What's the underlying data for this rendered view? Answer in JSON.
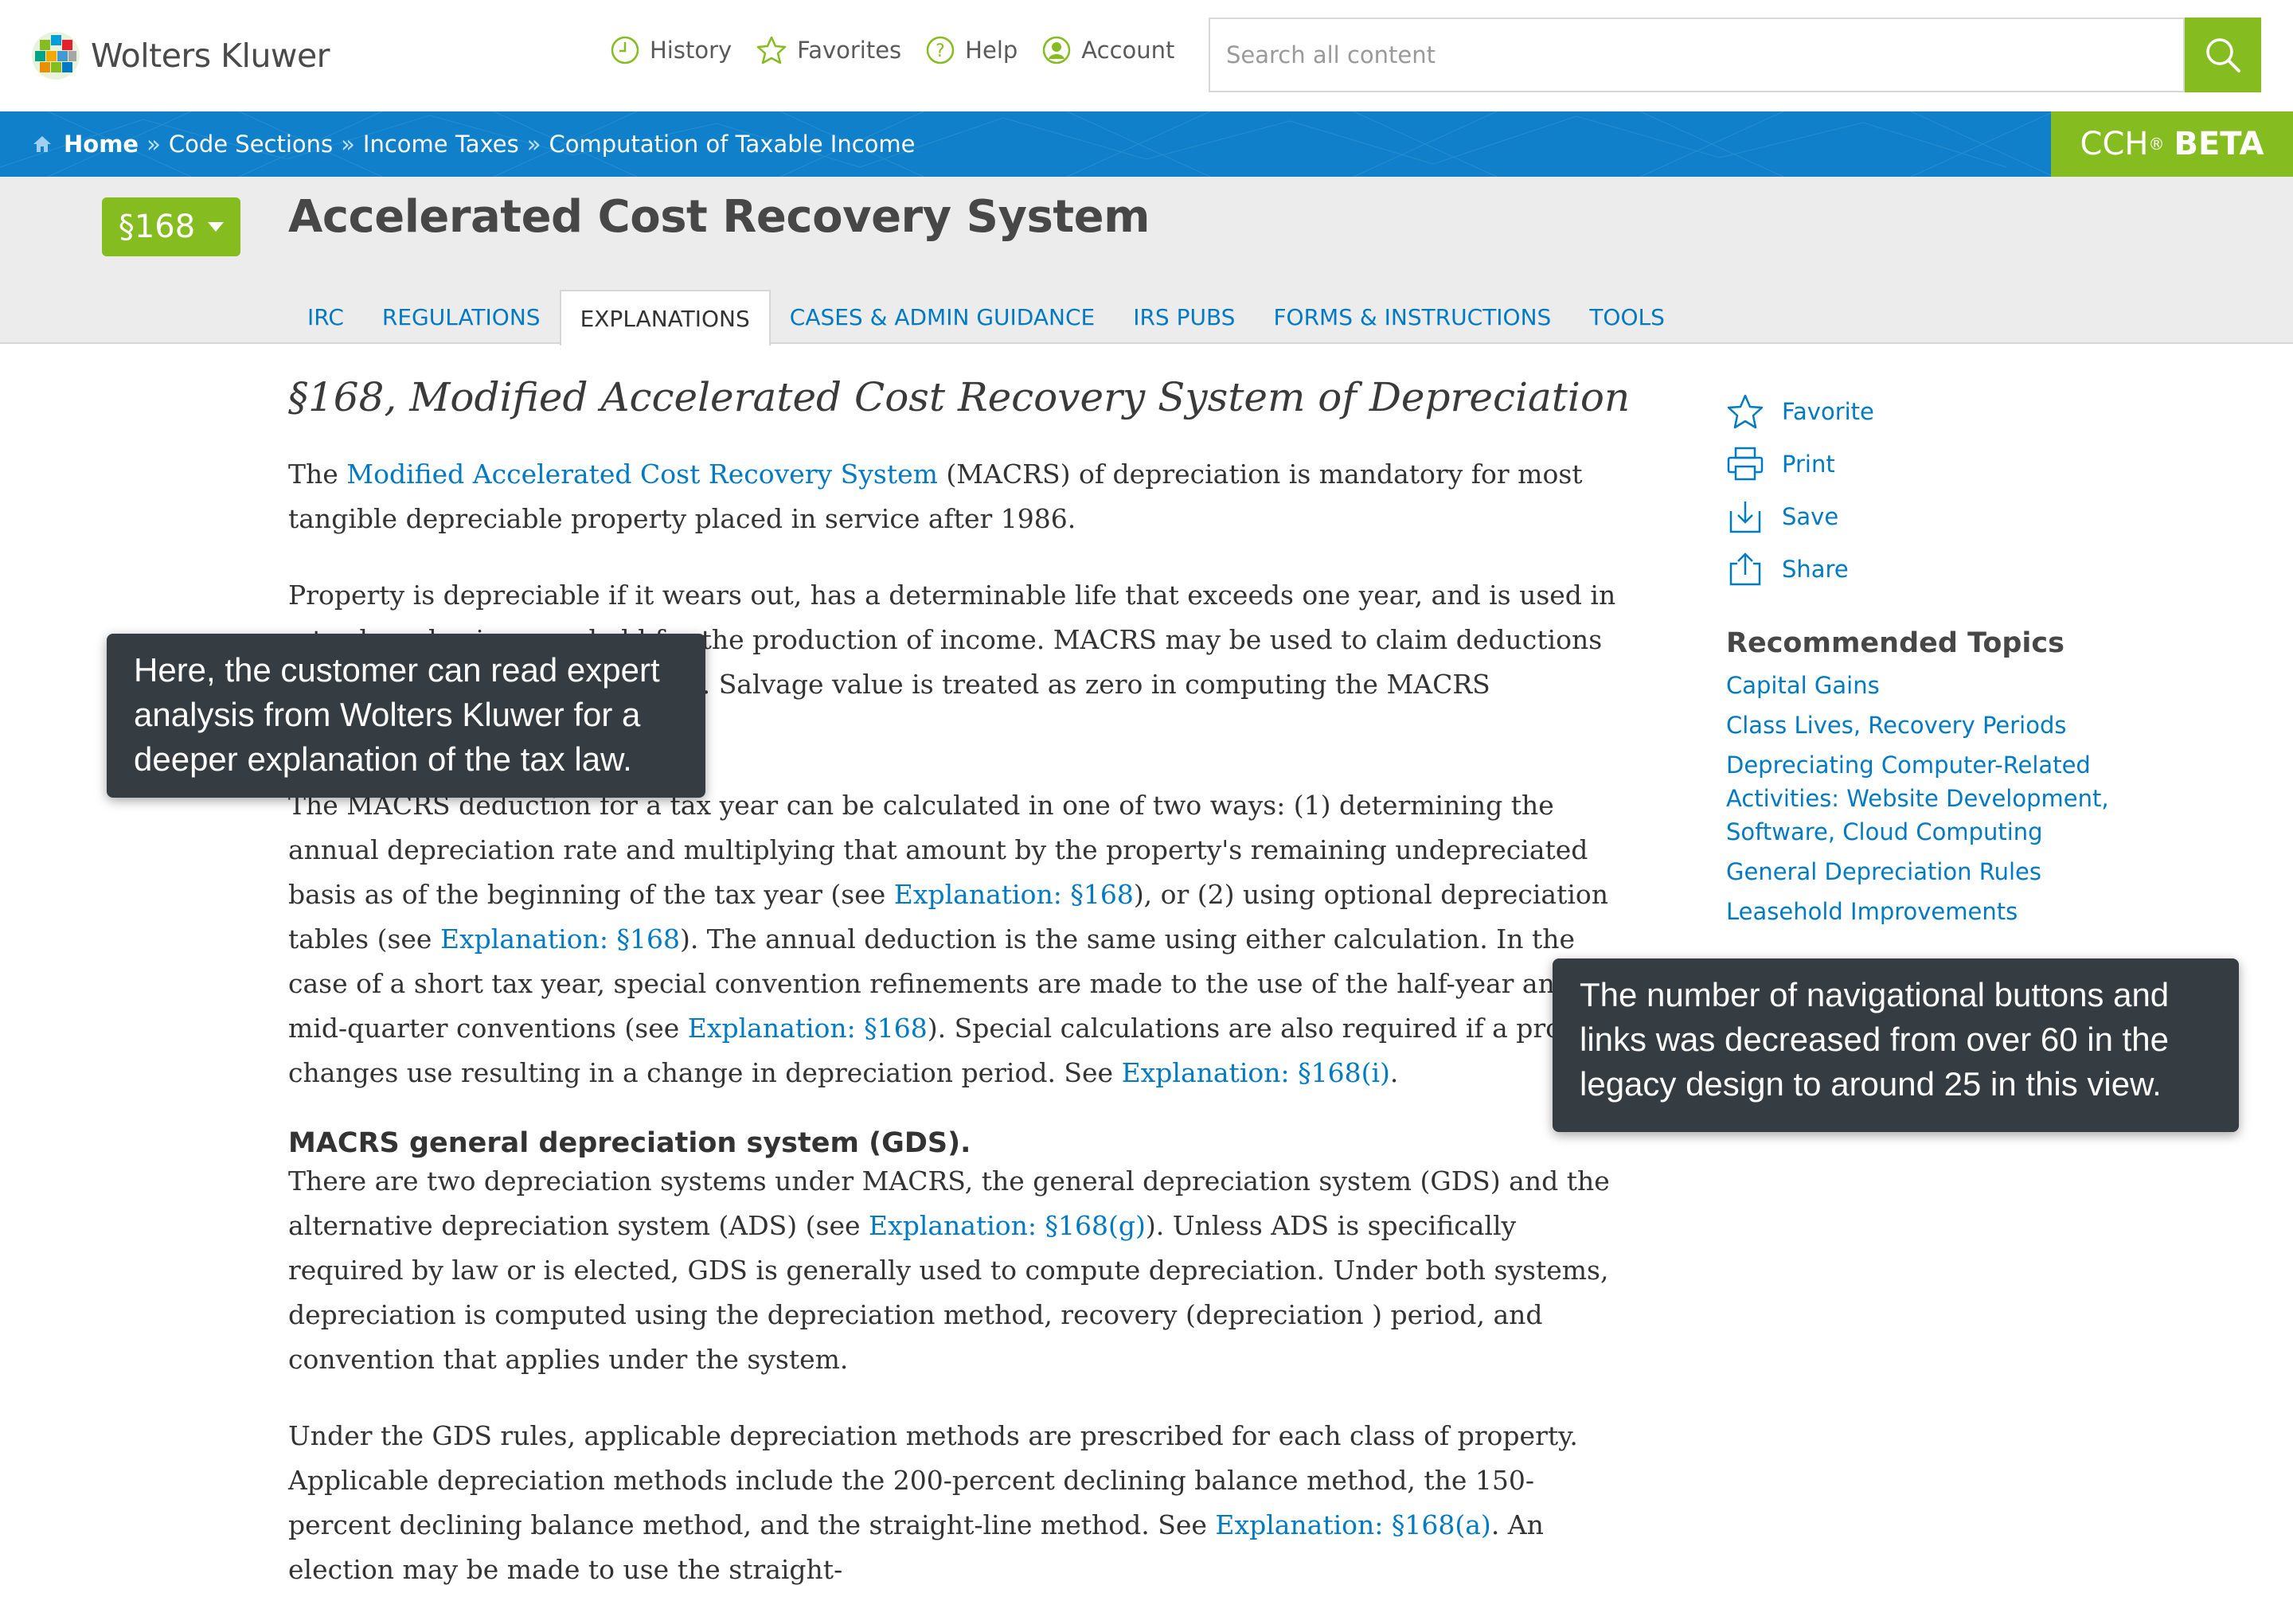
{
  "header": {
    "brand": "Wolters Kluwer",
    "nav": [
      {
        "label": "History",
        "icon": "clock-icon"
      },
      {
        "label": "Favorites",
        "icon": "star-icon"
      },
      {
        "label": "Help",
        "icon": "help-icon"
      },
      {
        "label": "Account",
        "icon": "account-icon"
      }
    ],
    "search_placeholder": "Search all content",
    "colors": {
      "accent": "#85bc20",
      "nav_blue": "#0f80c9",
      "link": "#007ac3"
    }
  },
  "breadcrumb": {
    "items": [
      "Home",
      "Code Sections",
      "Income Taxes",
      "Computation of Taxable Income"
    ],
    "separator": "»",
    "badge_cch": "CCH",
    "badge_reg": "®",
    "badge_beta": "BETA"
  },
  "title_area": {
    "section_button": "§168",
    "title": "Accelerated Cost Recovery System",
    "tabs": [
      "IRC",
      "REGULATIONS",
      "EXPLANATIONS",
      "CASES & ADMIN GUIDANCE",
      "IRS PUBS",
      "FORMS & INSTRUCTIONS",
      "TOOLS"
    ],
    "active_tab": "EXPLANATIONS"
  },
  "article": {
    "heading": "§168, Modified Accelerated Cost Recovery System of Depreciation",
    "p1_pre": "The ",
    "p1_link": "Modified Accelerated Cost Recovery System",
    "p1_post": " (MACRS) of depreciation is mandatory for most tangible depreciable property placed in service after 1986.",
    "p2": "Property is depreciable if it wears out, has a determinable life that exceeds one year, and is used in a trade or business or held for the production of income. MACRS may be used to claim deductions on both new and used property. Salvage value is treated as zero in computing the MACRS deduction.",
    "p3_a": "The MACRS deduction for a tax year can be calculated in one of two ways: (1) determining the annual depreciation rate and multiplying that amount by the property's remaining undepreciated basis as of the beginning of the tax year (see ",
    "p3_link1": "Explanation: §168",
    "p3_b": "), or (2) using optional depreciation tables (see ",
    "p3_link2": "Explanation: §168",
    "p3_c": "). The annual deduction is the same using either calculation. In the case of a short tax year, special convention refinements are made to the use of the half-year and the mid-quarter conventions (see ",
    "p3_link3": "Explanation: §168",
    "p3_d": "). Special calculations are also required if a property changes use resulting in a change in depreciation period. See ",
    "p3_link4": "Explanation: §168(i)",
    "p3_e": ".",
    "subheading": "MACRS general depreciation system (GDS).",
    "p4_a": "There are two depreciation systems under MACRS, the general depreciation system (GDS) and the alternative depreciation system (ADS) (see ",
    "p4_link": "Explanation: §168(g)",
    "p4_b": "). Unless ADS is specifically required by law or is elected, GDS is generally used to compute depreciation. Under both systems, depreciation is computed using the depreciation method, recovery (depreciation ) period, and convention that applies under the system.",
    "p5_a": "Under the GDS rules, applicable depreciation methods are prescribed for each class of property. Applicable depreciation methods include the 200-percent declining balance method, the 150-percent declining balance method, and the straight-line method. See ",
    "p5_link": "Explanation: §168(a)",
    "p5_b": ". An election may be made to use the straight-"
  },
  "sidebar": {
    "actions": [
      {
        "label": "Favorite",
        "icon": "star-icon"
      },
      {
        "label": "Print",
        "icon": "print-icon"
      },
      {
        "label": "Save",
        "icon": "download-icon"
      },
      {
        "label": "Share",
        "icon": "share-icon"
      }
    ],
    "recommended_title": "Recommended Topics",
    "recommended": [
      "Capital Gains",
      "Class Lives, Recovery Periods",
      "Depreciating Computer-Related Activities: Website Development, Software, Cloud Computing",
      "General Depreciation Rules",
      "Leasehold Improvements"
    ]
  },
  "callouts": [
    "Here, the customer can read expert analysis from Wolters Kluwer for a deeper explanation of the tax law.",
    "The number of navigational buttons and links was decreased from over 60 in the legacy design to around 25 in this view."
  ]
}
